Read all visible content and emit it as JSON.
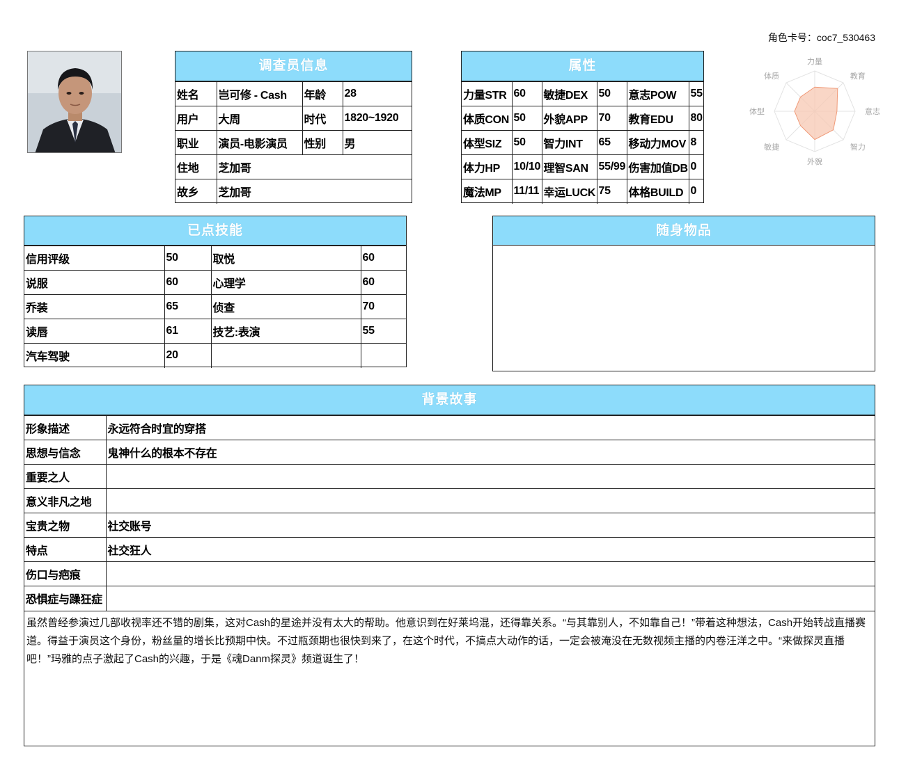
{
  "card_number": "角色卡号：coc7_530463",
  "info": {
    "title": "调查员信息",
    "rows": [
      [
        "姓名",
        "岂可修 - Cash",
        "年龄",
        "28"
      ],
      [
        "用户",
        "大周",
        "时代",
        "1820~1920"
      ],
      [
        "职业",
        "演员-电影演员",
        "性别",
        "男"
      ],
      [
        "住地",
        "芝加哥"
      ],
      [
        "故乡",
        "芝加哥"
      ]
    ]
  },
  "attributes": {
    "title": "属性",
    "rows": [
      [
        "力量STR",
        "60",
        "敏捷DEX",
        "50",
        "意志POW",
        "55"
      ],
      [
        "体质CON",
        "50",
        "外貌APP",
        "70",
        "教育EDU",
        "80"
      ],
      [
        "体型SIZ",
        "50",
        "智力INT",
        "65",
        "移动力MOV",
        "8"
      ],
      [
        "体力HP",
        "10/10",
        "理智SAN",
        "55/99",
        "伤害加值DB",
        "0"
      ],
      [
        "魔法MP",
        "11/11",
        "幸运LUCK",
        "75",
        "体格BUILD",
        "0"
      ]
    ]
  },
  "radar": {
    "labels": [
      "力量",
      "教育",
      "意志",
      "智力",
      "外貌",
      "敏捷",
      "体型",
      "体质"
    ],
    "values": [
      60,
      80,
      55,
      65,
      70,
      50,
      50,
      50
    ],
    "max": 100,
    "fill_color": "#f7c8b3",
    "stroke_color": "#f09a78",
    "grid_color": "#e3e3e3"
  },
  "skills": {
    "title": "已点技能",
    "rows": [
      [
        "信用评级",
        "50",
        "取悦",
        "60"
      ],
      [
        "说服",
        "60",
        "心理学",
        "60"
      ],
      [
        "乔装",
        "65",
        "侦查",
        "70"
      ],
      [
        "读唇",
        "61",
        "技艺:表演",
        "55"
      ],
      [
        "汽车驾驶",
        "20",
        "",
        ""
      ]
    ]
  },
  "items": {
    "title": "随身物品"
  },
  "story": {
    "title": "背景故事",
    "rows": [
      [
        "形象描述",
        "永远符合时宜的穿搭"
      ],
      [
        "思想与信念",
        "鬼神什么的根本不存在"
      ],
      [
        "重要之人",
        ""
      ],
      [
        "意义非凡之地",
        ""
      ],
      [
        "宝贵之物",
        "社交账号"
      ],
      [
        "特点",
        "社交狂人"
      ],
      [
        "伤口与疤痕",
        ""
      ],
      [
        "恐惧症与躁狂症",
        ""
      ]
    ],
    "text": "虽然曾经参演过几部收视率还不错的剧集，这对Cash的星途并没有太大的帮助。他意识到在好莱坞混，还得靠关系。“与其靠别人，不如靠自己！”带着这种想法，Cash开始转战直播赛道。得益于演员这个身份，粉丝量的增长比预期中快。不过瓶颈期也很快到来了，在这个时代，不搞点大动作的话，一定会被淹没在无数视频主播的内卷汪洋之中。“来做探灵直播吧！”玛雅的点子激起了Cash的兴趣，于是《魂Danm探灵》频道诞生了！"
  }
}
